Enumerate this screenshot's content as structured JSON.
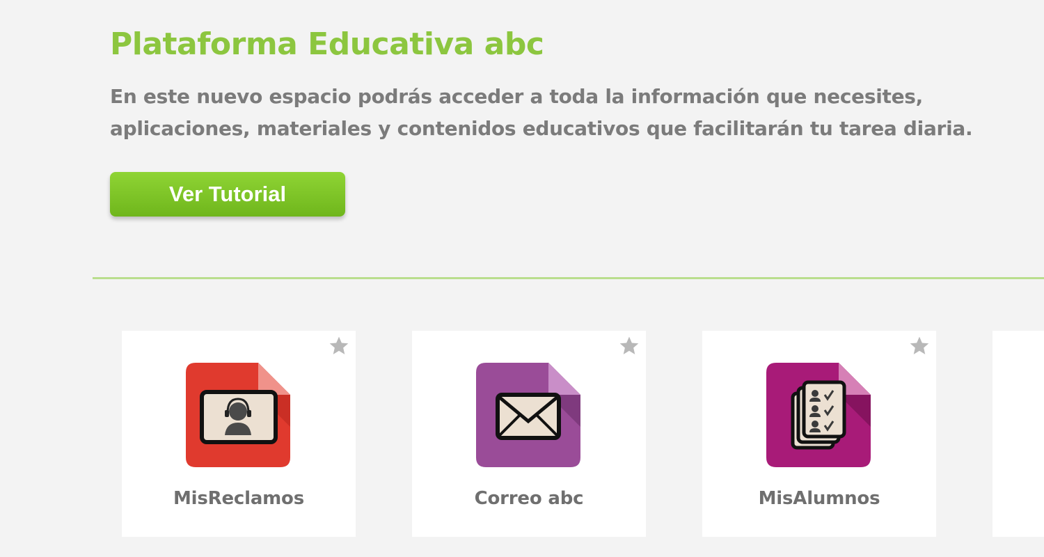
{
  "hero": {
    "title": "Plataforma Educativa abc",
    "description_lines": [
      "En este nuevo espacio podrás acceder a toda la información que necesites,",
      "aplicaciones, materiales y contenidos educativos que facilitarán tu tarea diaria."
    ],
    "tutorial_button_label": "Ver Tutorial"
  },
  "colors": {
    "accent_green": "#8cc63f",
    "button_green": "#7cc229",
    "text_gray": "#7b7b7b",
    "red_app": "#e03a2e",
    "purple_app": "#9a4c98",
    "magenta_app": "#a81b78"
  },
  "apps": [
    {
      "label": "MisReclamos",
      "icon": "support-agent-icon"
    },
    {
      "label": "Correo abc",
      "icon": "envelope-icon"
    },
    {
      "label": "MisAlumnos",
      "icon": "student-list-icon"
    }
  ]
}
